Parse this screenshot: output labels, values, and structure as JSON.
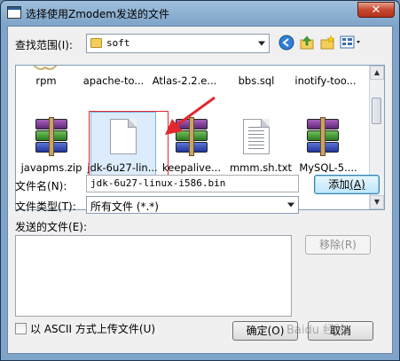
{
  "window": {
    "title": "选择使用Zmodem发送的文件",
    "close_glyph": "✕"
  },
  "lookin": {
    "label": "查找范围",
    "accel": "(I):",
    "value": "soft"
  },
  "files": {
    "row1": [
      "rpm",
      "apache-to...",
      "Atlas-2.2.e...",
      "bbs.sql",
      "inotify-too..."
    ],
    "row2": [
      "javapms.zip",
      "jdk-6u27-lin...",
      "keepalive...",
      "mmm.sh.txt",
      "MySQL-5...."
    ]
  },
  "filename": {
    "label": "文件名",
    "accel": "(N):",
    "value": "jdk-6u27-linux-i586.bin"
  },
  "filetype": {
    "label": "文件类型",
    "accel": "(T):",
    "value": "所有文件 (*.*)"
  },
  "sent_files": {
    "label": "发送的文件",
    "accel": "(E):"
  },
  "buttons": {
    "add": "添加",
    "add_accel": "(A)",
    "remove": "移除",
    "remove_accel": "(R)",
    "ok": "确定",
    "ok_accel": "(O)",
    "cancel": "取消"
  },
  "ascii": {
    "label": "以 ASCII 方式上传文件",
    "accel": "(U)"
  },
  "watermark": "Baidu 经验",
  "colors": {
    "annotation": "#e0282e"
  }
}
